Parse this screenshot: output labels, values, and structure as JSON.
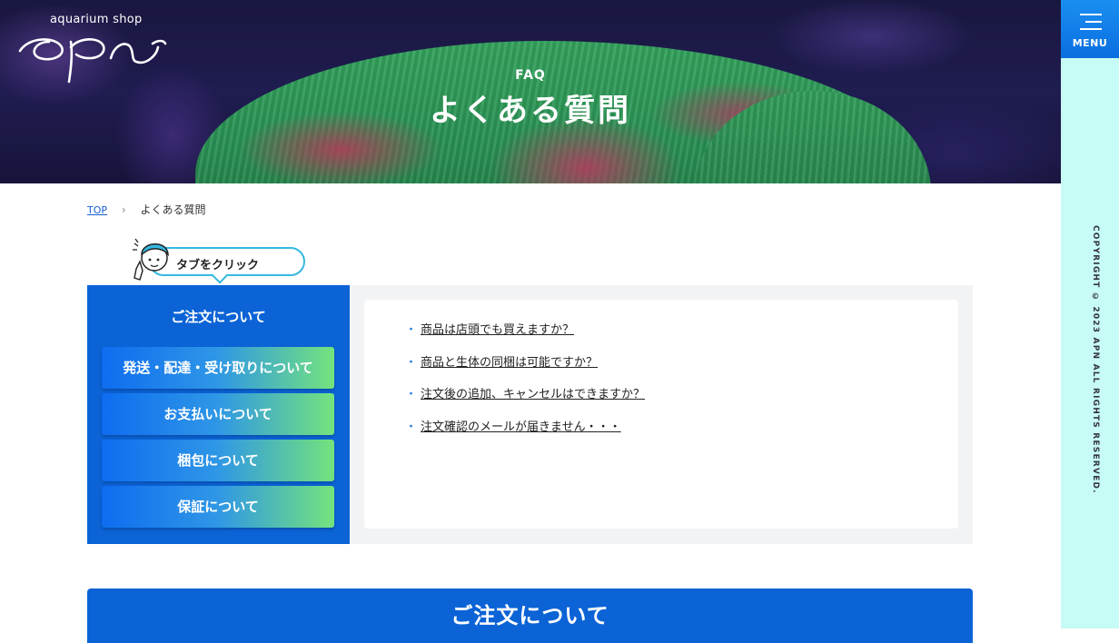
{
  "header": {
    "logo_small": "aquarium shop",
    "logo_main": "apn",
    "page_sub": "FAQ",
    "page_title": "よくある質問"
  },
  "menu": {
    "label": "MENU"
  },
  "copyright": "COPYRIGHT © 2023 APN ALL RIGHTS RESERVED.",
  "breadcrumb": {
    "home": "TOP",
    "separator": "›",
    "current": "よくある質問"
  },
  "hint": {
    "text": "タブをクリック"
  },
  "tabs": {
    "active": "ご注文について",
    "items": [
      {
        "label": "発送・配達・受け取りについて"
      },
      {
        "label": "お支払いについて"
      },
      {
        "label": "梱包について"
      },
      {
        "label": "保証について"
      }
    ]
  },
  "questions": [
    "商品は店頭でも買えますか？",
    "商品と生体の同梱は可能ですか？",
    "注文後の追加、キャンセルはできますか？",
    "注文確認のメールが届きません・・・"
  ],
  "section": {
    "title": "ご注文について"
  },
  "colors": {
    "primary_blue": "#0b63d6",
    "side_bar": "#c7fbf5",
    "tab_gradient_start": "#0e6cf0",
    "tab_gradient_end": "#74e37c"
  }
}
